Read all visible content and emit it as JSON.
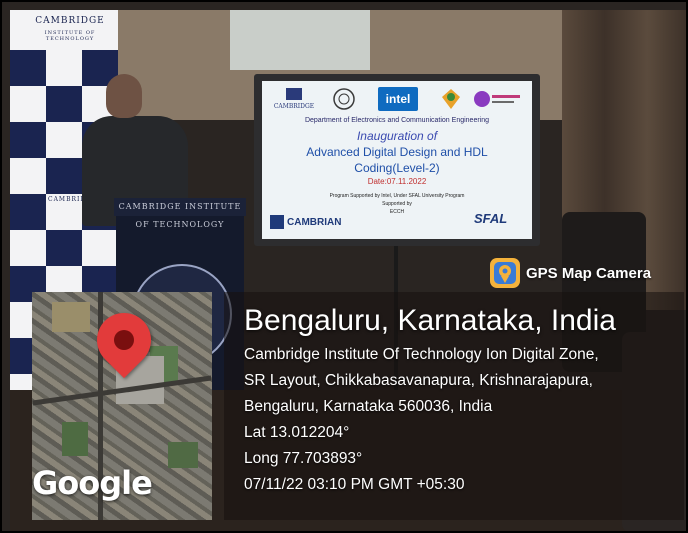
{
  "backdrop": {
    "banner_text": "CAMBRIDGE",
    "banner_subtext": "INSTITUTE OF TECHNOLOGY",
    "podium_text": "CAMBRIDGE INSTITUTE OF TECHNOLOGY"
  },
  "slide": {
    "department": "Department of Electronics and Communication Engineering",
    "event_title": "Inauguration of",
    "course_line1": "Advanced Digital Design and HDL",
    "course_line2": "Coding(Level-2)",
    "date": "Date:07.11.2022",
    "support_line": "Program Supported by Intel, Under SFAL University Program",
    "supported_by": "Supported by",
    "supporter": "ECCH",
    "intel_logo": "intel",
    "cambrian_logo": "CAMBRIAN",
    "sfal_logo": "SFAL",
    "cambridge_logo": "CAMBRIDGE"
  },
  "gps_badge": {
    "label": "GPS Map Camera",
    "icon": "gps-map-camera-icon"
  },
  "location": {
    "title": "Bengaluru, Karnataka, India",
    "address_lines": [
      "Cambridge Institute Of Technology Ion Digital Zone,",
      "SR Layout, Chikkabasavanapura, Krishnarajapura,",
      "Bengaluru, Karnataka 560036, India"
    ],
    "lat": "Lat 13.012204°",
    "long": "Long 77.703893°",
    "timestamp": "07/11/22 03:10 PM GMT +05:30"
  },
  "map": {
    "watermark": "Google",
    "pin_color": "#e23b3b",
    "icon": "map-pin-icon"
  }
}
